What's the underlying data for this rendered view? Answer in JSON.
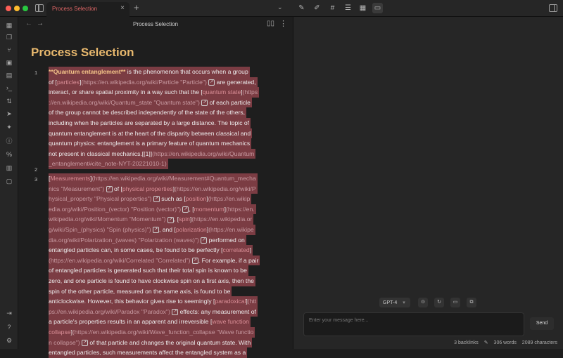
{
  "tab": {
    "label": "Process Selection",
    "close": "×"
  },
  "new_tab": "+",
  "tabs_chevron": "⌄",
  "toolbar_icons": [
    "brush-icon",
    "brush-settings-icon",
    "hash-icon",
    "list-icon",
    "calendar-icon",
    "chat-icon"
  ],
  "ribbon_icons": [
    "calendar-icon",
    "copy-icon",
    "graph-icon",
    "grid-icon",
    "pages-icon",
    "terminal-icon",
    "sliders-icon",
    "send-icon",
    "bird-icon",
    "help-circle-icon",
    "percent-icon",
    "calendar-today-icon",
    "chat-bubble-icon",
    "publish-icon",
    "help-icon",
    "settings-icon"
  ],
  "editor": {
    "nav_back": "←",
    "nav_forward": "→",
    "view_title": "Process Selection",
    "doc_title": "Process Selection",
    "line_numbers": [
      "1",
      "2",
      "3"
    ]
  },
  "copilot": {
    "model": "GPT-4",
    "model_chevron": "▾",
    "input_placeholder": "Enter your message here...",
    "send_label": "Send"
  },
  "status": {
    "backlinks": "3 backlinks",
    "words": "306 words",
    "characters": "2089 characters"
  }
}
